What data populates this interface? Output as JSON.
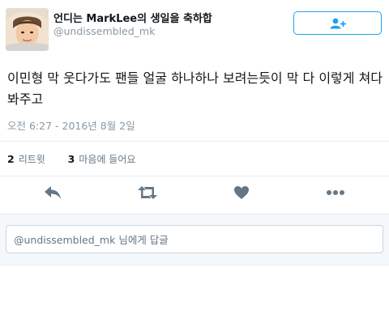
{
  "tweet": {
    "display_name": "언디는 MarkLee의 생일을 축하합",
    "handle": "@undissembled_mk",
    "text": "이민형 막 웃다가도 팬들 얼굴 하나하나 보려는듯이 막 다 이렇게 쳐다봐주고",
    "timestamp": "오전 6:27 - 2016년 8월 2일"
  },
  "stats": {
    "retweets_count": "2",
    "retweets_label": "리트윗",
    "likes_count": "3",
    "likes_label": "마음에 들어요"
  },
  "reply": {
    "placeholder": "@undissembled_mk 님에게 답글"
  },
  "icons": {
    "follow": "add-user-icon",
    "reply": "reply-arrow-icon",
    "retweet": "retweet-icon",
    "like": "heart-icon",
    "more": "more-dots-icon"
  },
  "colors": {
    "accent": "#1da1f2",
    "icon_gray": "#657786",
    "muted_text": "#8899a6"
  }
}
